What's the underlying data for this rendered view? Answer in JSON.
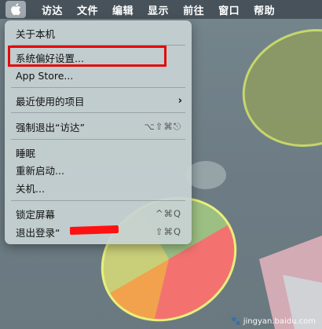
{
  "menubar": {
    "apple_icon": "apple-logo-icon",
    "items": [
      {
        "label": "访达"
      },
      {
        "label": "文件"
      },
      {
        "label": "编辑"
      },
      {
        "label": "显示"
      },
      {
        "label": "前往"
      },
      {
        "label": "窗口"
      },
      {
        "label": "帮助"
      }
    ]
  },
  "apple_menu": {
    "items": [
      {
        "label": "关于本机",
        "shortcut": ""
      },
      {
        "label": "系统偏好设置...",
        "shortcut": ""
      },
      {
        "label": "App Store...",
        "shortcut": ""
      },
      {
        "label": "最近使用的项目",
        "shortcut": "",
        "submenu": true
      },
      {
        "label": "强制退出“访达”",
        "shortcut": "⌥⇧⌘⎋"
      },
      {
        "label": "睡眠",
        "shortcut": ""
      },
      {
        "label": "重新启动...",
        "shortcut": ""
      },
      {
        "label": "关机...",
        "shortcut": ""
      },
      {
        "label": "锁定屏幕",
        "shortcut": "^⌘Q"
      },
      {
        "label": "退出登录“",
        "shortcut": "⇧⌘Q"
      }
    ],
    "highlight_color": "#e20b0b"
  },
  "watermark": {
    "text": "jingyan.baidu.com"
  }
}
